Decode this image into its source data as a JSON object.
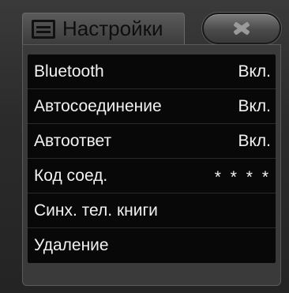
{
  "header": {
    "title": "Настройки",
    "title_icon": "settings-list-icon",
    "close_icon": "close-icon"
  },
  "settings": {
    "items": [
      {
        "label": "Bluetooth",
        "value": "Вкл."
      },
      {
        "label": "Автосоединение",
        "value": "Вкл."
      },
      {
        "label": "Автоответ",
        "value": "Вкл."
      },
      {
        "label": "Код соед.",
        "value": "* * * *"
      },
      {
        "label": "Синх. тел. книги",
        "value": ""
      },
      {
        "label": "Удаление",
        "value": ""
      }
    ]
  },
  "colors": {
    "text": "#f2f2f2",
    "list_bg": "#080808",
    "frame": "#3a3a3a",
    "title_text": "#0e0e0e"
  }
}
